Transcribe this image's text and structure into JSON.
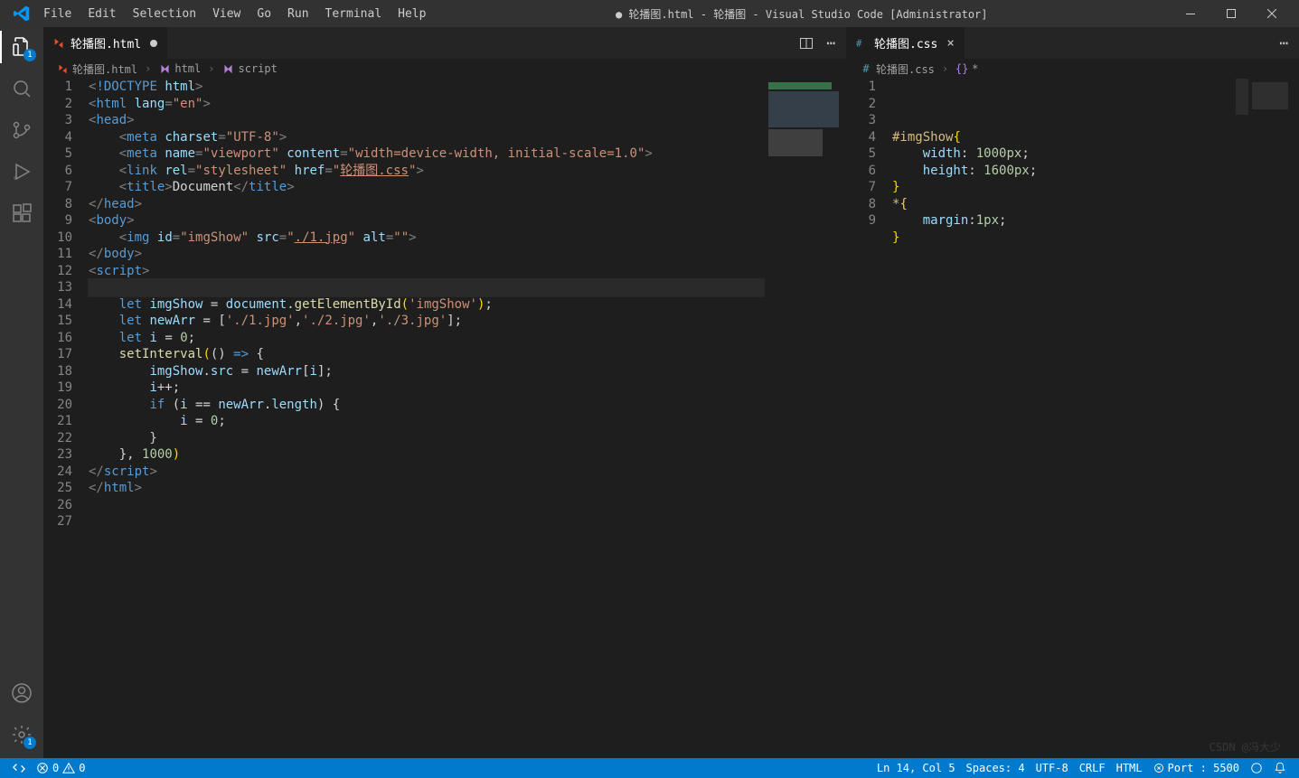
{
  "title": "● 轮播图.html - 轮播图 - Visual Studio Code [Administrator]",
  "menu": [
    "File",
    "Edit",
    "Selection",
    "View",
    "Go",
    "Run",
    "Terminal",
    "Help"
  ],
  "activity_badge_explorer": "1",
  "activity_badge_settings": "1",
  "left_tab": {
    "name": "轮播图.html",
    "dirty": true
  },
  "right_tab": {
    "name": "轮播图.css"
  },
  "breadcrumbs_left": [
    {
      "icon": "file-html",
      "label": "轮播图.html"
    },
    {
      "icon": "sym-tag",
      "label": "html"
    },
    {
      "icon": "sym-tag",
      "label": "script"
    }
  ],
  "breadcrumbs_right": [
    {
      "icon": "file-css",
      "label": "轮播图.css"
    },
    {
      "icon": "sym-brace",
      "label": "*"
    }
  ],
  "left_lines": 27,
  "left_code": [
    [
      [
        "<",
        "p"
      ],
      [
        "!",
        "d"
      ],
      [
        "DOCTYPE",
        "d"
      ],
      [
        " ",
        "p"
      ],
      [
        "html",
        "a"
      ],
      [
        ">",
        "p"
      ]
    ],
    [
      [
        "<",
        "p"
      ],
      [
        "html",
        "t"
      ],
      [
        " ",
        "p"
      ],
      [
        "lang",
        "a"
      ],
      [
        "=",
        "p"
      ],
      [
        "\"en\"",
        "s"
      ],
      [
        ">",
        "p"
      ]
    ],
    [
      [
        "<",
        "p"
      ],
      [
        "head",
        "t"
      ],
      [
        ">",
        "p"
      ]
    ],
    [
      [
        "    ",
        ""
      ],
      [
        "<",
        "p"
      ],
      [
        "meta",
        "t"
      ],
      [
        " ",
        ""
      ],
      [
        "charset",
        "a"
      ],
      [
        "=",
        "p"
      ],
      [
        "\"UTF-8\"",
        "s"
      ],
      [
        ">",
        "p"
      ]
    ],
    [
      [
        "    ",
        ""
      ],
      [
        "<",
        "p"
      ],
      [
        "meta",
        "t"
      ],
      [
        " ",
        ""
      ],
      [
        "name",
        "a"
      ],
      [
        "=",
        "p"
      ],
      [
        "\"viewport\"",
        "s"
      ],
      [
        " ",
        ""
      ],
      [
        "content",
        "a"
      ],
      [
        "=",
        "p"
      ],
      [
        "\"width=device-width, initial-scale=1.0\"",
        "s"
      ],
      [
        ">",
        "p"
      ]
    ],
    [
      [
        "    ",
        ""
      ],
      [
        "<",
        "p"
      ],
      [
        "link",
        "t"
      ],
      [
        " ",
        ""
      ],
      [
        "rel",
        "a"
      ],
      [
        "=",
        "p"
      ],
      [
        "\"stylesheet\"",
        "s"
      ],
      [
        " ",
        ""
      ],
      [
        "href",
        "a"
      ],
      [
        "=",
        "p"
      ],
      [
        "\"",
        "s"
      ],
      [
        "轮播图.css",
        "su"
      ],
      [
        "\"",
        "s"
      ],
      [
        ">",
        "p"
      ]
    ],
    [
      [
        "    ",
        ""
      ],
      [
        "<",
        "p"
      ],
      [
        "title",
        "t"
      ],
      [
        ">",
        "p"
      ],
      [
        "Document",
        "x"
      ],
      [
        "</",
        "p"
      ],
      [
        "title",
        "t"
      ],
      [
        ">",
        "p"
      ]
    ],
    [
      [
        "</",
        "p"
      ],
      [
        "head",
        "t"
      ],
      [
        ">",
        "p"
      ]
    ],
    [
      [
        "<",
        "p"
      ],
      [
        "body",
        "t"
      ],
      [
        ">",
        "p"
      ]
    ],
    [
      [
        "    ",
        ""
      ],
      [
        "<",
        "p"
      ],
      [
        "img",
        "t"
      ],
      [
        " ",
        ""
      ],
      [
        "id",
        "a"
      ],
      [
        "=",
        "p"
      ],
      [
        "\"imgShow\"",
        "s"
      ],
      [
        " ",
        ""
      ],
      [
        "src",
        "a"
      ],
      [
        "=",
        "p"
      ],
      [
        "\"",
        "s"
      ],
      [
        "./1.jpg",
        "su"
      ],
      [
        "\"",
        "s"
      ],
      [
        " ",
        ""
      ],
      [
        "alt",
        "a"
      ],
      [
        "=",
        "p"
      ],
      [
        "\"\"",
        "s"
      ],
      [
        ">",
        "p"
      ]
    ],
    [
      [
        "",
        ""
      ]
    ],
    [
      [
        "</",
        "p"
      ],
      [
        "body",
        "t"
      ],
      [
        ">",
        "p"
      ]
    ],
    [
      [
        "<",
        "p"
      ],
      [
        "script",
        "t"
      ],
      [
        ">",
        "p"
      ]
    ],
    [
      [
        "    ",
        ""
      ]
    ],
    [
      [
        "    ",
        ""
      ],
      [
        "let",
        "kw"
      ],
      [
        " ",
        ""
      ],
      [
        "imgShow",
        "i"
      ],
      [
        " = ",
        "x"
      ],
      [
        "document",
        "i"
      ],
      [
        ".",
        "x"
      ],
      [
        "getElementById",
        "f"
      ],
      [
        "(",
        "y"
      ],
      [
        "'imgShow'",
        "s"
      ],
      [
        ")",
        "y"
      ],
      [
        ";",
        "x"
      ]
    ],
    [
      [
        "    ",
        ""
      ],
      [
        "let",
        "kw"
      ],
      [
        " ",
        ""
      ],
      [
        "newArr",
        "i"
      ],
      [
        " = [",
        "x"
      ],
      [
        "'./1.jpg'",
        "s"
      ],
      [
        ",",
        "x"
      ],
      [
        "'./2.jpg'",
        "s"
      ],
      [
        ",",
        "x"
      ],
      [
        "'./3.jpg'",
        "s"
      ],
      [
        "];",
        "x"
      ]
    ],
    [
      [
        "    ",
        ""
      ],
      [
        "let",
        "kw"
      ],
      [
        " ",
        ""
      ],
      [
        "i",
        "i"
      ],
      [
        " = ",
        "x"
      ],
      [
        "0",
        "n"
      ],
      [
        ";",
        "x"
      ]
    ],
    [
      [
        "    ",
        ""
      ],
      [
        "setInterval",
        "f"
      ],
      [
        "(",
        "y"
      ],
      [
        "() ",
        "x"
      ],
      [
        "=>",
        "kw"
      ],
      [
        " {",
        "x"
      ]
    ],
    [
      [
        "        ",
        ""
      ],
      [
        "imgShow",
        "i"
      ],
      [
        ".",
        "x"
      ],
      [
        "src",
        "i"
      ],
      [
        " = ",
        "x"
      ],
      [
        "newArr",
        "i"
      ],
      [
        "[",
        "x"
      ],
      [
        "i",
        "i"
      ],
      [
        "];",
        "x"
      ]
    ],
    [
      [
        "        ",
        ""
      ],
      [
        "i",
        "i"
      ],
      [
        "++;",
        "x"
      ]
    ],
    [
      [
        "        ",
        ""
      ],
      [
        "if",
        "kw"
      ],
      [
        " (",
        "x"
      ],
      [
        "i",
        "i"
      ],
      [
        " == ",
        "x"
      ],
      [
        "newArr",
        "i"
      ],
      [
        ".",
        "x"
      ],
      [
        "length",
        "i"
      ],
      [
        ") {",
        "x"
      ]
    ],
    [
      [
        "            ",
        ""
      ],
      [
        "i",
        "i"
      ],
      [
        " = ",
        "x"
      ],
      [
        "0",
        "n"
      ],
      [
        ";",
        "x"
      ]
    ],
    [
      [
        "        }",
        ""
      ]
    ],
    [
      [
        "    }, ",
        "x"
      ],
      [
        "1000",
        "n"
      ],
      [
        ")",
        "y"
      ]
    ],
    [
      [
        "",
        ""
      ]
    ],
    [
      [
        "</",
        "p"
      ],
      [
        "script",
        "t"
      ],
      [
        ">",
        "p"
      ]
    ],
    [
      [
        "</",
        "p"
      ],
      [
        "html",
        "t"
      ],
      [
        ">",
        "p"
      ]
    ]
  ],
  "left_current_line": 14,
  "right_lines": 9,
  "right_code": [
    [
      [
        "#imgShow",
        "sel"
      ],
      [
        "{",
        "y"
      ]
    ],
    [
      [
        "    ",
        ""
      ],
      [
        "width",
        "prop"
      ],
      [
        ": ",
        "x"
      ],
      [
        "1000px",
        "n"
      ],
      [
        ";",
        "x"
      ]
    ],
    [
      [
        "    ",
        ""
      ],
      [
        "height",
        "prop"
      ],
      [
        ": ",
        "x"
      ],
      [
        "1600px",
        "n"
      ],
      [
        ";",
        "x"
      ]
    ],
    [
      [
        "}",
        "y"
      ]
    ],
    [
      [
        "",
        ""
      ]
    ],
    [
      [
        "*",
        "sel"
      ],
      [
        "{",
        "y"
      ]
    ],
    [
      [
        "    ",
        ""
      ],
      [
        "margin",
        "prop"
      ],
      [
        ":",
        "x"
      ],
      [
        "1px",
        "n"
      ],
      [
        ";",
        "x"
      ]
    ],
    [
      [
        "",
        ""
      ]
    ],
    [
      [
        "}",
        "y"
      ]
    ]
  ],
  "statusbar": {
    "errors": "0",
    "warnings": "0",
    "cursor": "Ln 14, Col 5",
    "spaces": "Spaces: 4",
    "encoding": "UTF-8",
    "eol": "CRLF",
    "lang": "HTML",
    "port": "Port : 5500"
  },
  "watermark": "CSDN @冯大少"
}
